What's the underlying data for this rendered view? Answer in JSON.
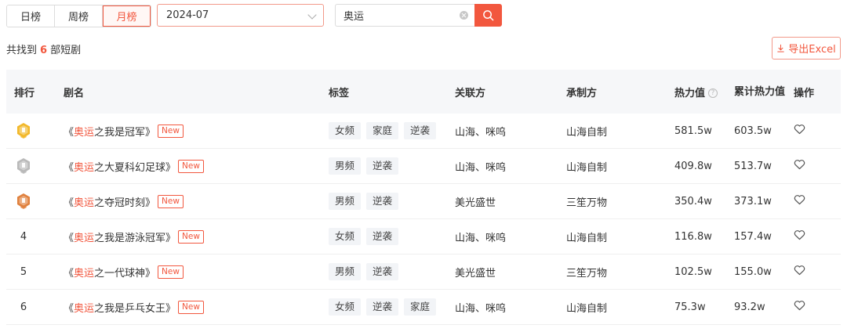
{
  "period_tabs": [
    {
      "label": "日榜",
      "active": false
    },
    {
      "label": "周榜",
      "active": false
    },
    {
      "label": "月榜",
      "active": true
    }
  ],
  "date_select": {
    "value": "2024-07"
  },
  "search": {
    "value": "奥运",
    "placeholder": ""
  },
  "result": {
    "prefix": "共找到",
    "count": "6",
    "suffix": "部短剧"
  },
  "export": {
    "label": "导出Excel"
  },
  "columns": {
    "rank": "排行",
    "name": "剧名",
    "tags": "标签",
    "related": "关联方",
    "maker": "承制方",
    "heat": "热力值",
    "total_heat": "累计热力值",
    "ops": "操作"
  },
  "new_badge": "New",
  "rows": [
    {
      "rank": "1",
      "medal": "gold",
      "open": "《",
      "hl": "奥运",
      "rest": "之我是冠军》",
      "tags": [
        "女频",
        "家庭",
        "逆袭"
      ],
      "related": "山海、咪呜",
      "maker": "山海自制",
      "heat": "581.5w",
      "total": "603.5w"
    },
    {
      "rank": "2",
      "medal": "silver",
      "open": "《",
      "hl": "奥运",
      "rest": "之大夏科幻足球》",
      "tags": [
        "男频",
        "逆袭"
      ],
      "related": "山海、咪呜",
      "maker": "山海自制",
      "heat": "409.8w",
      "total": "513.7w"
    },
    {
      "rank": "3",
      "medal": "bronze",
      "open": "《",
      "hl": "奥运",
      "rest": "之夺冠时刻》",
      "tags": [
        "男频",
        "逆袭"
      ],
      "related": "美光盛世",
      "maker": "三笙万物",
      "heat": "350.4w",
      "total": "373.1w"
    },
    {
      "rank": "4",
      "medal": "",
      "open": "《",
      "hl": "奥运",
      "rest": "之我是游泳冠军》",
      "tags": [
        "女频",
        "逆袭"
      ],
      "related": "山海、咪呜",
      "maker": "山海自制",
      "heat": "116.8w",
      "total": "157.4w"
    },
    {
      "rank": "5",
      "medal": "",
      "open": "《",
      "hl": "奥运",
      "rest": "之一代球神》",
      "tags": [
        "男频",
        "逆袭"
      ],
      "related": "美光盛世",
      "maker": "三笙万物",
      "heat": "102.5w",
      "total": "155.0w"
    },
    {
      "rank": "6",
      "medal": "",
      "open": "《",
      "hl": "奥运",
      "rest": "之我是乒乓女王》",
      "tags": [
        "女频",
        "逆袭",
        "家庭"
      ],
      "related": "山海、咪呜",
      "maker": "山海自制",
      "heat": "75.3w",
      "total": "93.2w"
    }
  ],
  "colors": {
    "accent": "#f2573e",
    "gold": "#f2b82a",
    "silver": "#b9b9b9",
    "bronze": "#e0813e"
  }
}
